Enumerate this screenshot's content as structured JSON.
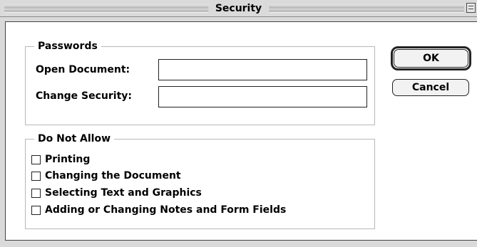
{
  "window": {
    "title": "Security"
  },
  "passwords": {
    "legend": "Passwords",
    "open_document_label": "Open Document:",
    "open_document_value": "",
    "change_security_label": "Change Security:",
    "change_security_value": ""
  },
  "do_not_allow": {
    "legend": "Do Not Allow",
    "items": [
      {
        "label": "Printing",
        "checked": false
      },
      {
        "label": "Changing the Document",
        "checked": false
      },
      {
        "label": "Selecting Text and Graphics",
        "checked": false
      },
      {
        "label": "Adding or Changing Notes and Form Fields",
        "checked": false
      }
    ]
  },
  "buttons": {
    "ok_label": "OK",
    "cancel_label": "Cancel"
  },
  "icons": {
    "collapse": "window-collapse-icon"
  },
  "colors": {
    "titlebar": "#dadada",
    "groupbox_border": "#b8b8b8",
    "background": "#ffffff"
  }
}
